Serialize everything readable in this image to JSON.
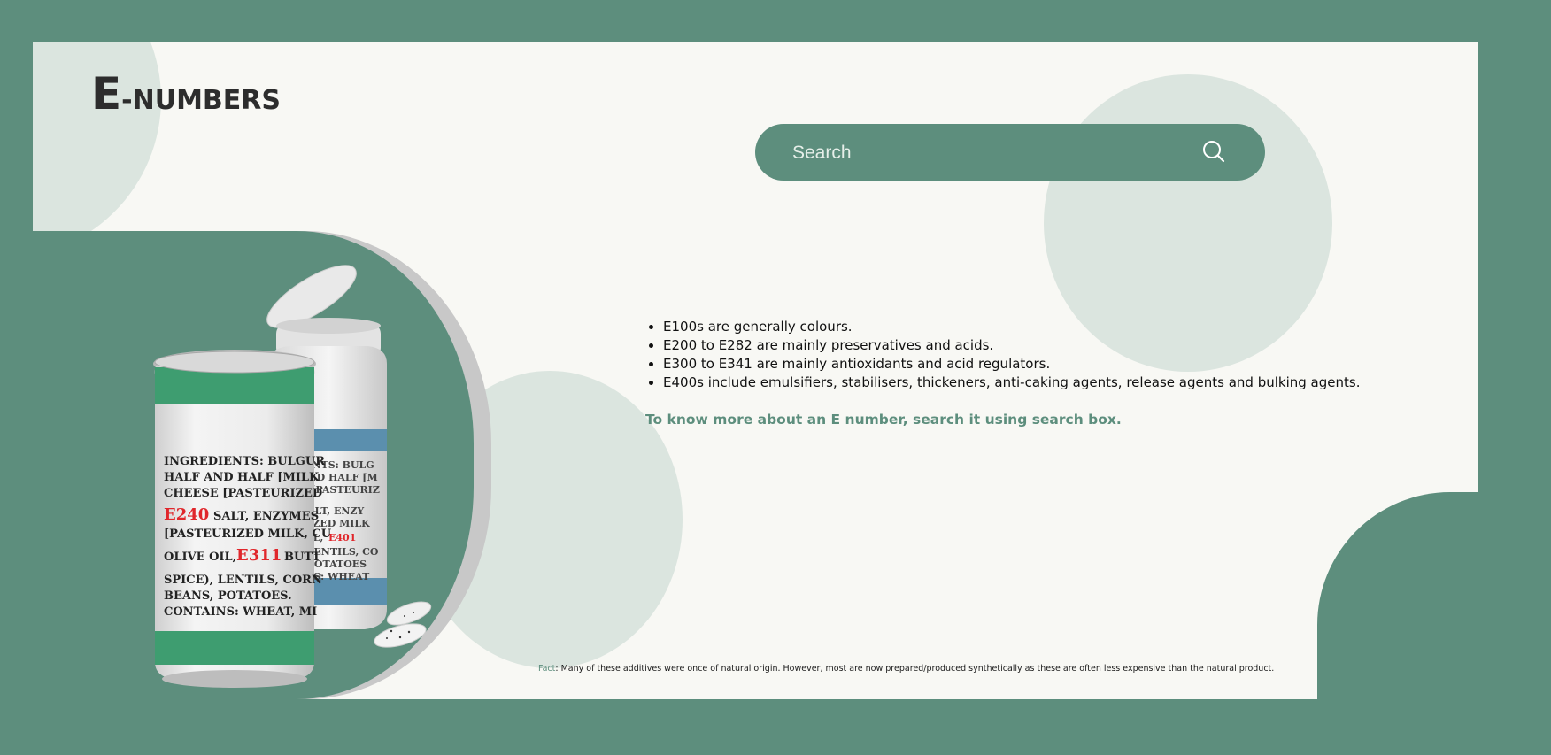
{
  "brand": {
    "logo_e": "E",
    "logo_rest": "-NUMBERS"
  },
  "search": {
    "placeholder": "Search",
    "value": "",
    "icon": "search-icon"
  },
  "info": {
    "items": [
      "E100s are generally colours.",
      "E200 to E282 are mainly preservatives and acids.",
      "E300 to E341 are mainly antioxidants and acid regulators.",
      "E400s include emulsifiers, stabilisers, thickeners, anti-caking agents, release agents and bulking agents."
    ],
    "cta": "To know more about an E number, search it using search box."
  },
  "fact": {
    "label": "Fact",
    "text": ": Many of these additives were once of natural origin. However, most are now prepared/produced synthetically as these are often less expensive than the natural product."
  },
  "illustration": {
    "can_lines": [
      "INGREDIENTS: BULGUR",
      "HALF AND HALF [MILK",
      "CHEESE [PASTEURIZED",
      "SALT, ENZYMES",
      "[PASTEURIZED MILK, CU",
      "OLIVE OIL,",
      "BUTT",
      "SPICE), LENTILS, CORN",
      "BEANS, POTATOES.",
      "CONTAINS: WHEAT, MI"
    ],
    "can_codes": [
      "E240",
      "E311"
    ],
    "bottle_code": "E401",
    "colors": {
      "accent": "#5d8e7d",
      "background": "#f8f8f4",
      "circle": "#dbe5df",
      "code_red": "#e0262b",
      "bottle_band": "#5b8fae",
      "can_band": "#3e9d70"
    }
  }
}
